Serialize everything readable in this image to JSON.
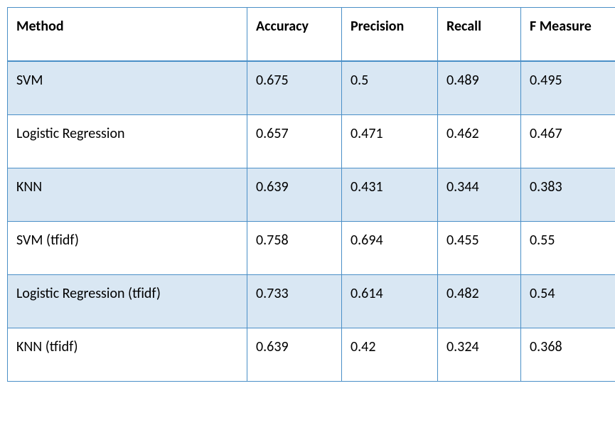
{
  "chart_data": {
    "type": "table",
    "title": "",
    "columns": [
      "Method",
      "Accuracy",
      "Precision",
      "Recall",
      "F Measure"
    ],
    "rows": [
      {
        "method": "SVM",
        "accuracy": 0.675,
        "precision": 0.5,
        "recall": 0.489,
        "f_measure": 0.495
      },
      {
        "method": "Logistic Regression",
        "accuracy": 0.657,
        "precision": 0.471,
        "recall": 0.462,
        "f_measure": 0.467
      },
      {
        "method": "KNN",
        "accuracy": 0.639,
        "precision": 0.431,
        "recall": 0.344,
        "f_measure": 0.383
      },
      {
        "method": "SVM (tfidf)",
        "accuracy": 0.758,
        "precision": 0.694,
        "recall": 0.455,
        "f_measure": 0.55
      },
      {
        "method": "Logistic Regression (tfidf)",
        "accuracy": 0.733,
        "precision": 0.614,
        "recall": 0.482,
        "f_measure": 0.54
      },
      {
        "method": "KNN (tfidf)",
        "accuracy": 0.639,
        "precision": 0.42,
        "recall": 0.324,
        "f_measure": 0.368
      }
    ]
  }
}
